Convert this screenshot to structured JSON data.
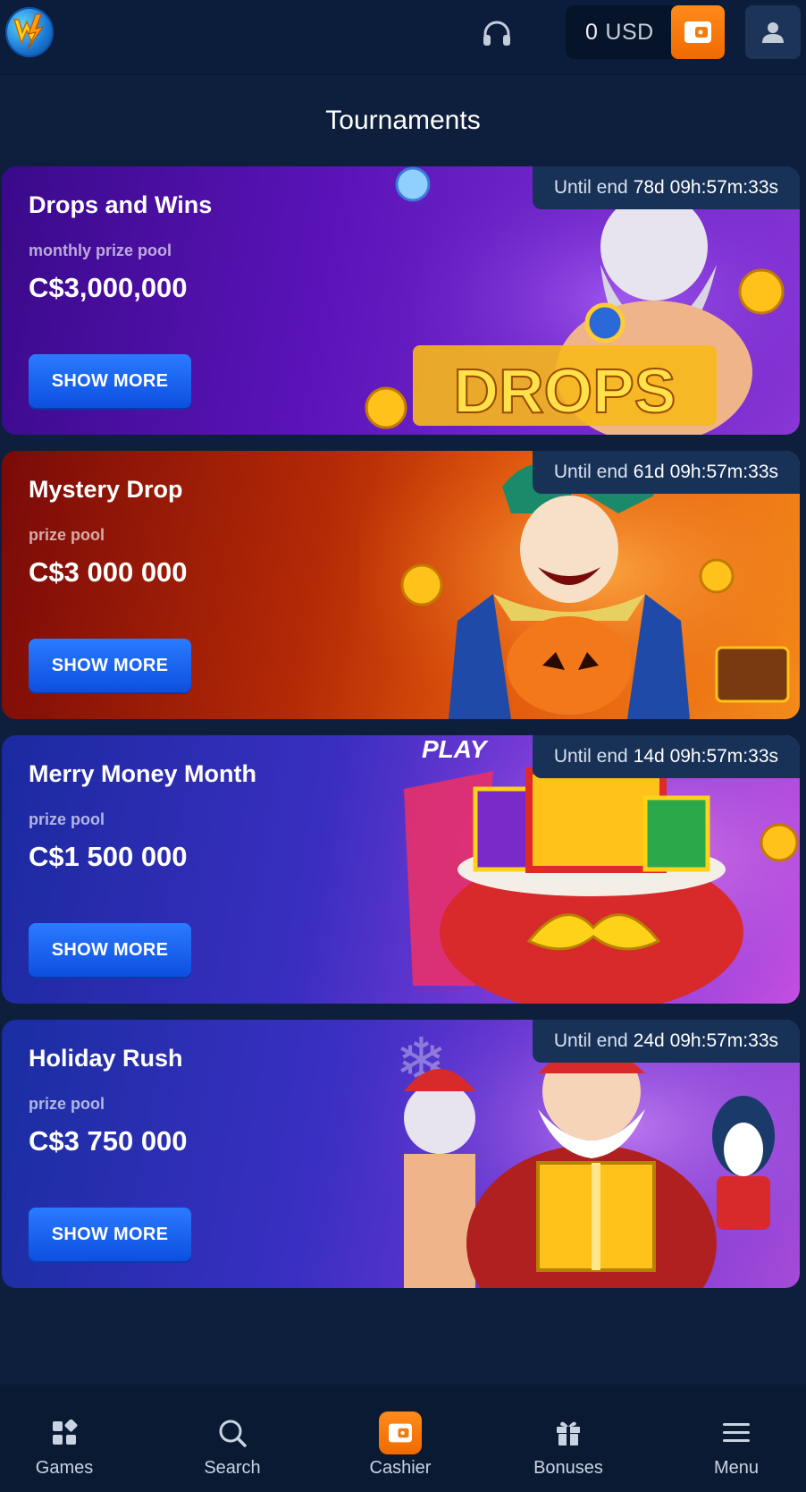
{
  "header": {
    "balance_amount": "0",
    "balance_currency": "USD"
  },
  "page": {
    "title": "Tournaments"
  },
  "tournaments": [
    {
      "title": "Drops and Wins",
      "pool_label": "monthly prize pool",
      "prize": "C$3,000,000",
      "button": "SHOW MORE",
      "until_label": "Until end",
      "until_time": "78d 09h:57m:33s"
    },
    {
      "title": "Mystery Drop",
      "pool_label": "prize pool",
      "prize": "C$3 000 000",
      "button": "SHOW MORE",
      "until_label": "Until end",
      "until_time": "61d 09h:57m:33s"
    },
    {
      "title": "Merry Money Month",
      "pool_label": "prize pool",
      "prize": "C$1 500 000",
      "button": "SHOW MORE",
      "until_label": "Until end",
      "until_time": "14d 09h:57m:33s"
    },
    {
      "title": "Holiday Rush",
      "pool_label": "prize pool",
      "prize": "C$3 750 000",
      "button": "SHOW MORE",
      "until_label": "Until end",
      "until_time": "24d 09h:57m:33s"
    }
  ],
  "bottom_nav": [
    {
      "label": "Games",
      "icon": "games-grid-icon"
    },
    {
      "label": "Search",
      "icon": "search-icon"
    },
    {
      "label": "Cashier",
      "icon": "wallet-icon"
    },
    {
      "label": "Bonuses",
      "icon": "gift-icon"
    },
    {
      "label": "Menu",
      "icon": "hamburger-menu-icon"
    }
  ],
  "colors": {
    "background": "#0d1f3c",
    "header": "#0b1d3a",
    "accent_orange": "#f47a0a",
    "button_blue": "#1a64f0"
  }
}
